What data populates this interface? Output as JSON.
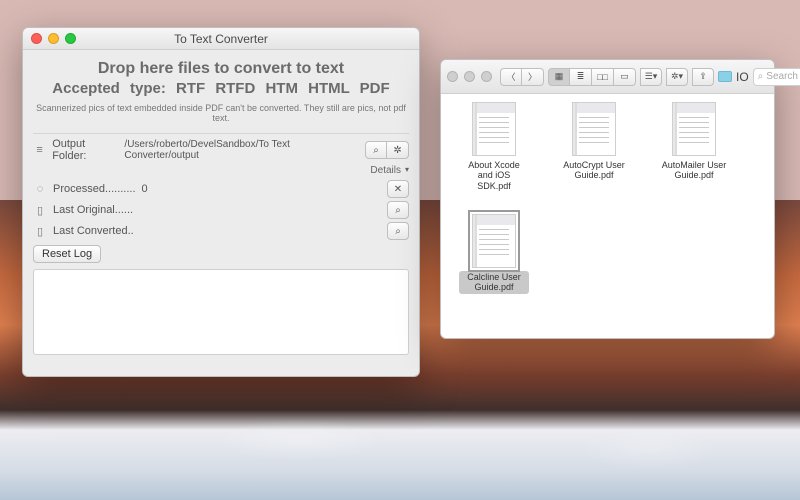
{
  "converter": {
    "title": "To Text Converter",
    "heading": "Drop here files to convert to text",
    "accepted_line": "Accepted type:   RTF  RTFD  HTM  HTML  PDF",
    "subnote": "Scannerized pics of text embedded inside PDF can't be converted. They still are pics, not pdf text.",
    "output_folder_label": "Output Folder:",
    "output_folder_path": "/Users/roberto/DevelSandbox/To Text Converter/output",
    "details_label": "Details",
    "processed_label": "Processed..........",
    "processed_count": "0",
    "last_original_label": "Last Original......",
    "last_converted_label": "Last Converted..",
    "reset_button": "Reset Log"
  },
  "finder": {
    "title": "IO",
    "search_placeholder": "Search",
    "files": [
      {
        "name": "About Xcode and iOS SDK.pdf",
        "selected": false
      },
      {
        "name": "AutoCrypt User Guide.pdf",
        "selected": false
      },
      {
        "name": "AutoMailer User Guide.pdf",
        "selected": false
      },
      {
        "name": "Calcline User Guide.pdf",
        "selected": true
      }
    ]
  }
}
